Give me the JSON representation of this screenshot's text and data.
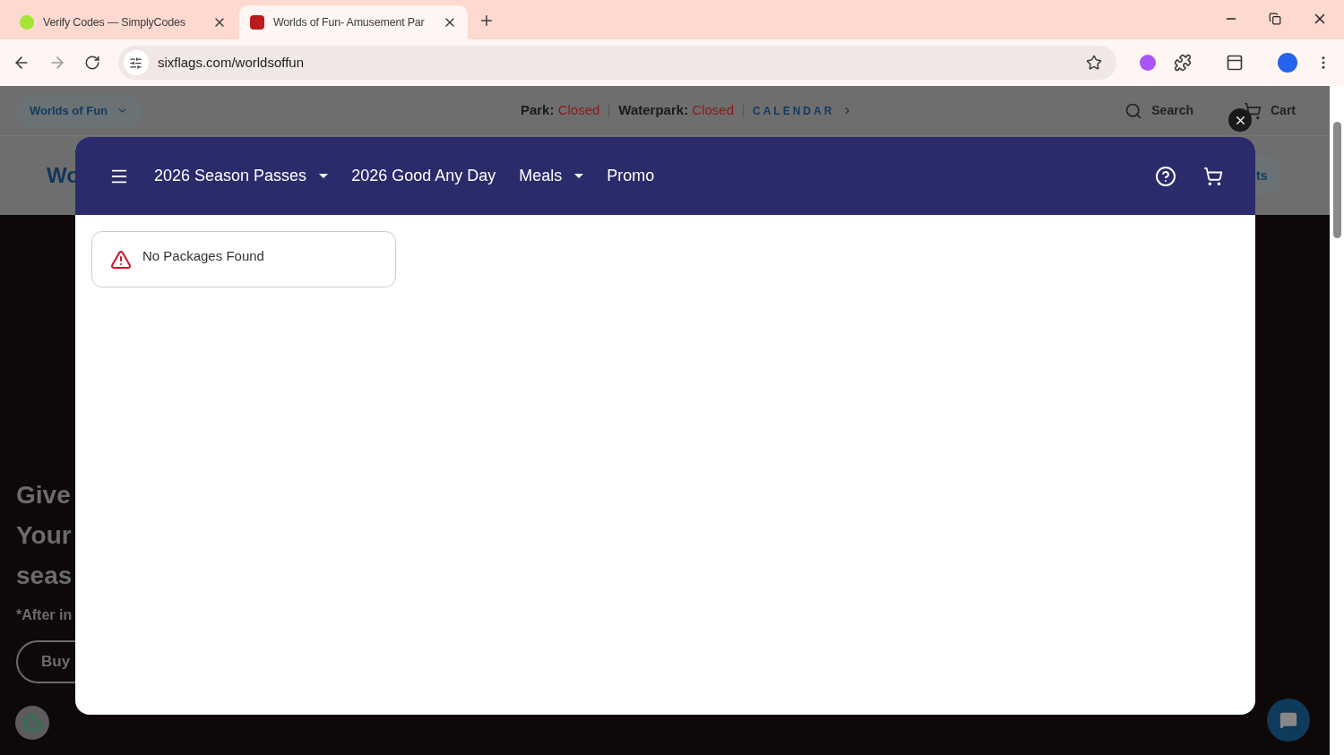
{
  "browser": {
    "tabs": [
      {
        "title": "Verify Codes — SimplyCodes",
        "selected": false
      },
      {
        "title": "Worlds of Fun- Amusement Par",
        "selected": true
      }
    ],
    "address": "sixflags.com/worldsoffun"
  },
  "site": {
    "park_selector": "Worlds of Fun",
    "status": [
      {
        "label": "Park:",
        "value": "Closed"
      },
      {
        "label": "Waterpark:",
        "value": "Closed"
      }
    ],
    "calendar_link": "CALENDAR",
    "search": "Search",
    "cart": "Cart",
    "logo_text": "Wo",
    "nav_pill": "ts",
    "hero": {
      "lines": [
        "Give",
        "Your",
        "seas"
      ],
      "note": "*After in",
      "button": "Buy"
    }
  },
  "modal": {
    "nav": [
      {
        "label": "2026 Season Passes",
        "dropdown": true
      },
      {
        "label": "2026 Good Any Day",
        "dropdown": false
      },
      {
        "label": "Meals",
        "dropdown": true
      },
      {
        "label": "Promo",
        "dropdown": false
      }
    ],
    "message": "No Packages Found"
  }
}
